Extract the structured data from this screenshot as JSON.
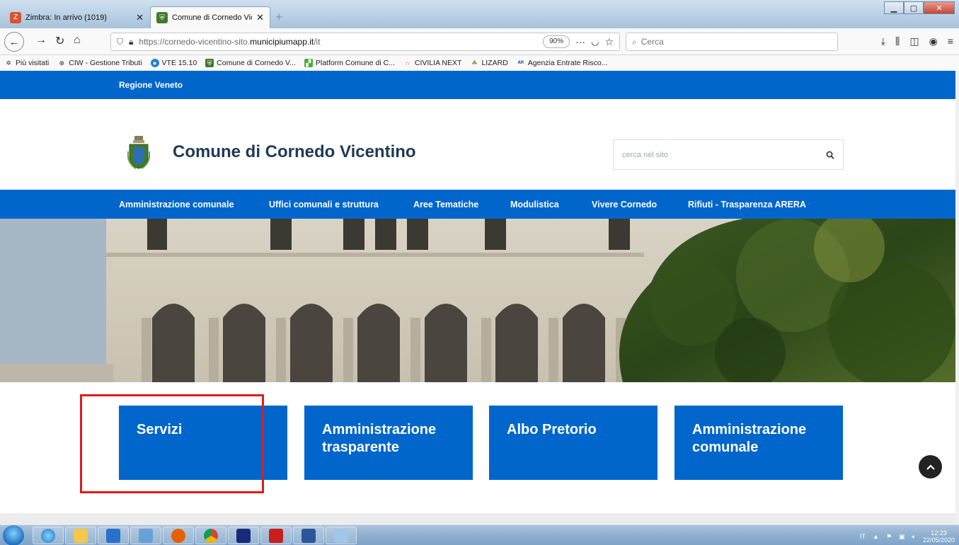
{
  "browser": {
    "tabs": [
      {
        "title": "Zimbra: In arrivo (1019)",
        "active": false
      },
      {
        "title": "Comune di Cornedo Vicentino",
        "active": true
      }
    ],
    "url_prefix": "https://cornedo-vicentino-sito.",
    "url_domain": "municipiumapp.it",
    "url_path": "/it",
    "zoom": "90%",
    "search_placeholder": "Cerca",
    "bookmarks": [
      {
        "label": "Più visitati",
        "icon": "gear-icon"
      },
      {
        "label": "CIW - Gestione Tributi",
        "icon": "globe-icon"
      },
      {
        "label": "VTE 15.10",
        "icon": "vte-icon"
      },
      {
        "label": "Comune di Cornedo V...",
        "icon": "crest-icon"
      },
      {
        "label": "Platform Comune di C...",
        "icon": "platform-icon"
      },
      {
        "label": "CIVILIA NEXT",
        "icon": "civilia-icon"
      },
      {
        "label": "LIZARD",
        "icon": "lizard-icon"
      },
      {
        "label": "Agenzia Entrate Risco...",
        "icon": "ar-icon"
      }
    ]
  },
  "site": {
    "region": "Regione Veneto",
    "title": "Comune di Cornedo Vicentino",
    "search_placeholder": "cerca nel sito",
    "menu": [
      "Amministrazione comunale",
      "Uffici comunali e struttura",
      "Aree Tematiche",
      "Modulistica",
      "Vivere Cornedo",
      "Rifiuti - Trasparenza ARERA"
    ],
    "cards": [
      {
        "line1": "Servizi",
        "line2": ""
      },
      {
        "line1": "Amministrazione",
        "line2": "trasparente"
      },
      {
        "line1": "Albo Pretorio",
        "line2": ""
      },
      {
        "line1": "Amministrazione",
        "line2": "comunale"
      }
    ]
  },
  "taskbar": {
    "language": "IT",
    "time": "12:23",
    "date": "22/05/2020"
  },
  "colors": {
    "brand_blue": "#0066cc",
    "highlight_red": "#e01b1b"
  }
}
